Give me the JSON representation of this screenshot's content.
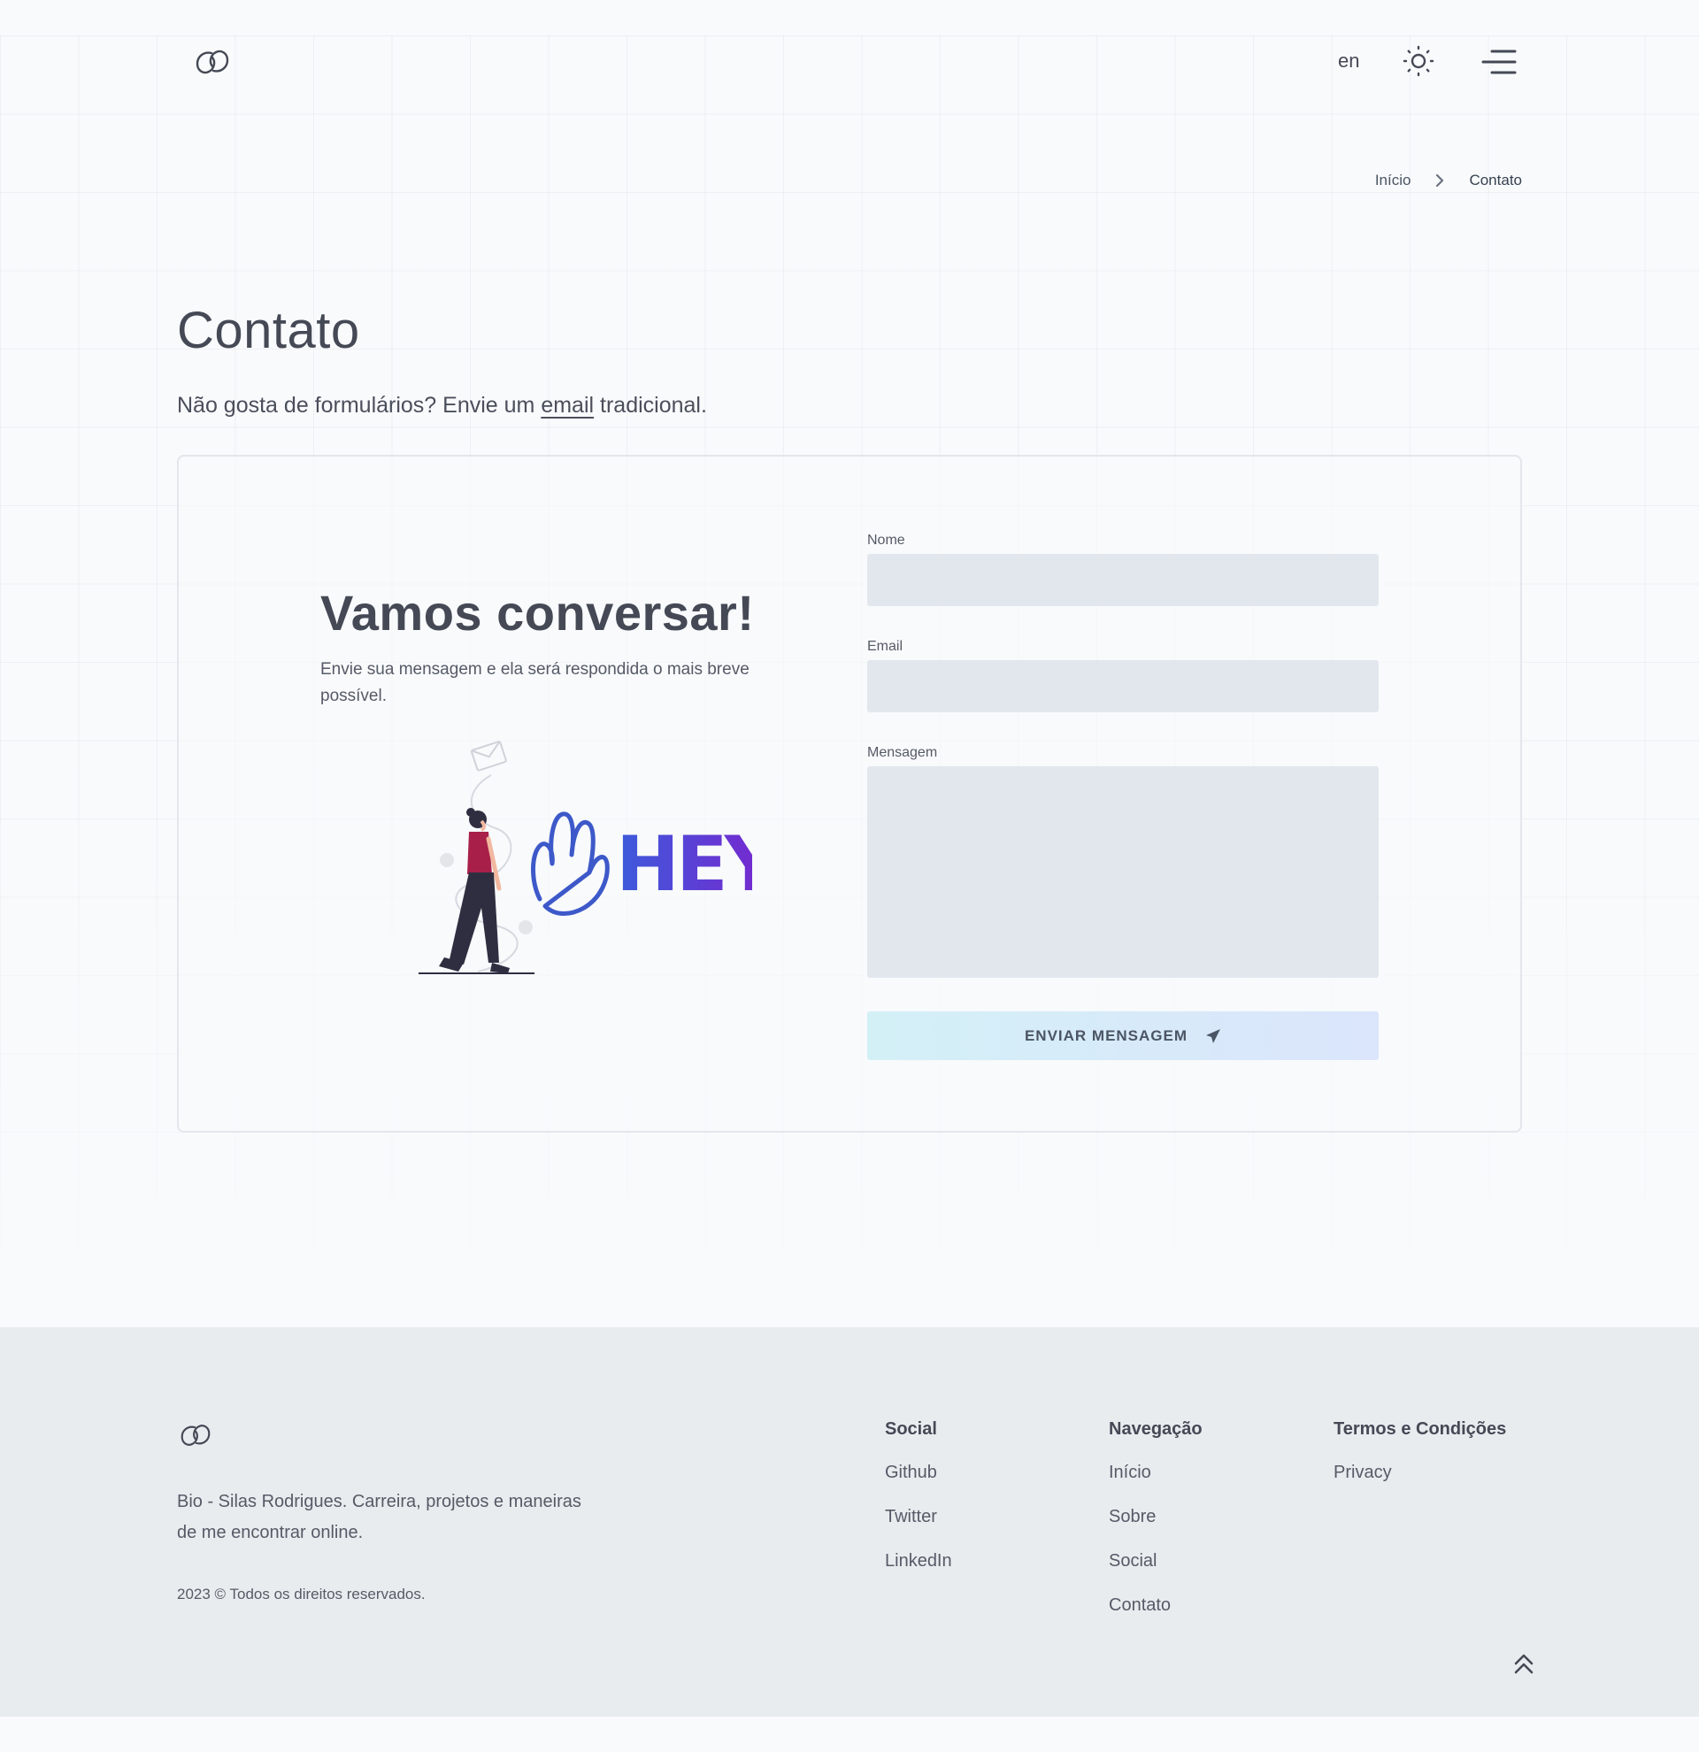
{
  "header": {
    "lang_label": "en"
  },
  "breadcrumb": {
    "home": "Início",
    "current": "Contato"
  },
  "page": {
    "title": "Contato",
    "lead_prefix": "Não gosta de formulários? Envie um ",
    "lead_link": "email",
    "lead_suffix": " tradicional."
  },
  "card": {
    "heading": "Vamos conversar!",
    "subtext": "Envie sua mensagem e ela será respondida o mais breve possível.",
    "illustration_text": "HEY"
  },
  "form": {
    "name_label": "Nome",
    "name_value": "",
    "email_label": "Email",
    "email_value": "",
    "message_label": "Mensagem",
    "message_value": "",
    "submit_label": "ENVIAR MENSAGEM"
  },
  "footer": {
    "bio": "Bio - Silas Rodrigues. Carreira, projetos e maneiras de me encontrar online.",
    "copyright": "2023 © Todos os direitos reservados.",
    "columns": [
      {
        "title": "Social",
        "links": [
          "Github",
          "Twitter",
          "LinkedIn"
        ]
      },
      {
        "title": "Navegação",
        "links": [
          "Início",
          "Sobre",
          "Social",
          "Contato"
        ]
      },
      {
        "title": "Termos e Condições",
        "links": [
          "Privacy"
        ]
      }
    ]
  },
  "colors": {
    "background": "#f8fafc",
    "text": "#454955",
    "input_bg": "#e2e7ee",
    "footer_bg": "#e9ecef",
    "hey_blue": "#3b5bdb",
    "hey_purple": "#6d28d9"
  },
  "icons": [
    "logo-icon",
    "sun-icon",
    "menu-icon",
    "chevron-right-icon",
    "send-icon",
    "chevrons-up-icon"
  ]
}
